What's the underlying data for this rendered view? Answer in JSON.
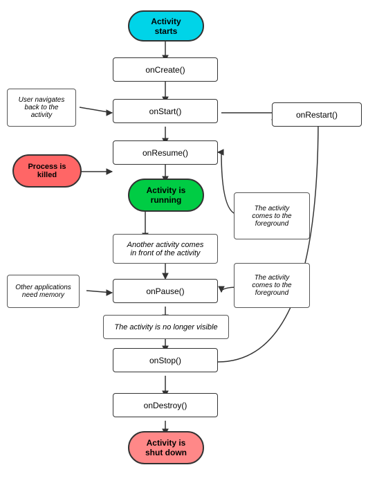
{
  "nodes": {
    "activity_starts": "Activity\nstarts",
    "onCreate": "onCreate()",
    "onStart": "onStart()",
    "onRestart": "onRestart()",
    "onResume": "onResume()",
    "activity_running": "Activity is\nrunning",
    "another_activity": "Another activity comes\nin front of the activity",
    "activity_foreground_1": "The activity\ncomes to the\nforeground",
    "onPause": "onPause()",
    "other_apps": "Other applications\nneed memory",
    "activity_foreground_2": "The activity\ncomes to the\nforeground",
    "no_longer_visible": "The activity is no longer visible",
    "onStop": "onStop()",
    "onDestroy": "onDestroy()",
    "activity_shutdown": "Activity is\nshut down",
    "user_navigates": "User navigates\nback to the\nactivity",
    "process_killed": "Process is\nkilled"
  }
}
